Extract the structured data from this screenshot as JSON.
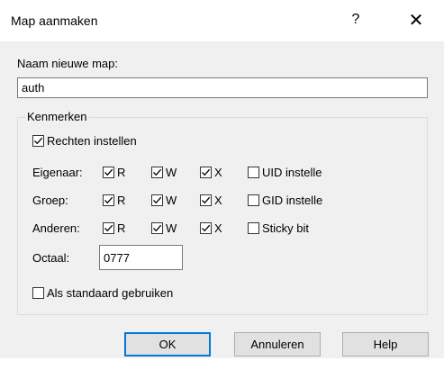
{
  "window": {
    "title": "Map aanmaken",
    "help_glyph": "?",
    "close_glyph": "✕"
  },
  "name": {
    "label": "Naam nieuwe map:",
    "value": "auth"
  },
  "group": {
    "legend": "Kenmerken",
    "set_rights": {
      "label": "Rechten instellen",
      "checked": true
    },
    "rows": [
      {
        "label": "Eigenaar:",
        "r": "R",
        "w": "W",
        "x": "X",
        "extra": "UID instelle",
        "r_checked": true,
        "w_checked": true,
        "x_checked": true,
        "extra_checked": false
      },
      {
        "label": "Groep:",
        "r": "R",
        "w": "W",
        "x": "X",
        "extra": "GID instelle",
        "r_checked": true,
        "w_checked": true,
        "x_checked": true,
        "extra_checked": false
      },
      {
        "label": "Anderen:",
        "r": "R",
        "w": "W",
        "x": "X",
        "extra": "Sticky bit",
        "r_checked": true,
        "w_checked": true,
        "x_checked": true,
        "extra_checked": false
      }
    ],
    "octal": {
      "label": "Octaal:",
      "value": "0777"
    },
    "use_default": {
      "label": "Als standaard gebruiken",
      "checked": false
    }
  },
  "buttons": {
    "ok": "OK",
    "cancel": "Annuleren",
    "help": "Help"
  },
  "colors": {
    "title_bg": "#ffffff",
    "dialog_bg": "#f0f0f0",
    "accent": "#0078d7"
  }
}
